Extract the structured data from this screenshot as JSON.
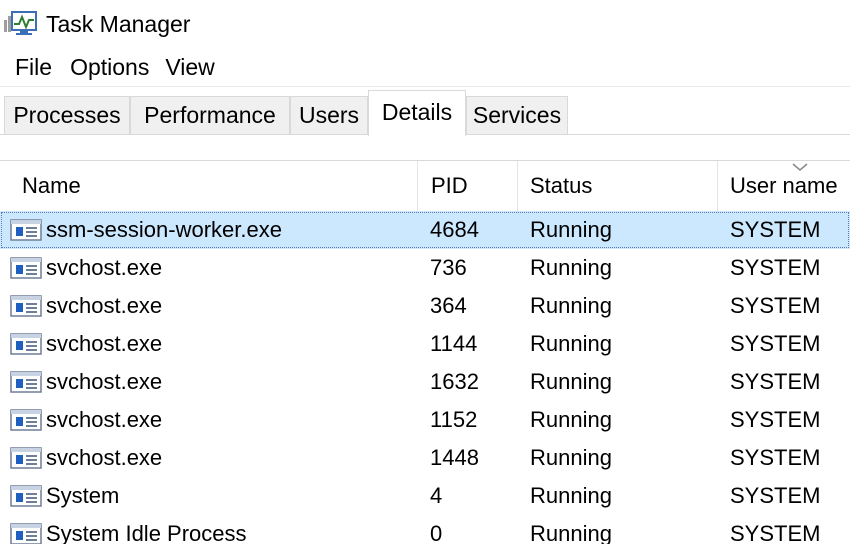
{
  "window": {
    "title": "Task Manager",
    "icon": "task-manager-icon"
  },
  "menu": {
    "items": [
      "File",
      "Options",
      "View"
    ]
  },
  "tabs": [
    {
      "label": "Processes",
      "active": false
    },
    {
      "label": "Performance",
      "active": false
    },
    {
      "label": "Users",
      "active": false
    },
    {
      "label": "Details",
      "active": true
    },
    {
      "label": "Services",
      "active": false
    }
  ],
  "table": {
    "columns": [
      "Name",
      "PID",
      "Status",
      "User name"
    ],
    "sorted_column": "User name",
    "rows": [
      {
        "name": "ssm-session-worker.exe",
        "pid": "4684",
        "status": "Running",
        "user": "SYSTEM",
        "selected": true
      },
      {
        "name": "svchost.exe",
        "pid": "736",
        "status": "Running",
        "user": "SYSTEM"
      },
      {
        "name": "svchost.exe",
        "pid": "364",
        "status": "Running",
        "user": "SYSTEM"
      },
      {
        "name": "svchost.exe",
        "pid": "1144",
        "status": "Running",
        "user": "SYSTEM"
      },
      {
        "name": "svchost.exe",
        "pid": "1632",
        "status": "Running",
        "user": "SYSTEM"
      },
      {
        "name": "svchost.exe",
        "pid": "1152",
        "status": "Running",
        "user": "SYSTEM"
      },
      {
        "name": "svchost.exe",
        "pid": "1448",
        "status": "Running",
        "user": "SYSTEM"
      },
      {
        "name": "System",
        "pid": "4",
        "status": "Running",
        "user": "SYSTEM"
      },
      {
        "name": "System Idle Process",
        "pid": "0",
        "status": "Running",
        "user": "SYSTEM"
      }
    ]
  },
  "colors": {
    "selection": "#cce8ff",
    "tab_inactive": "#f0f0f0",
    "border": "#d9d9d9",
    "icon_blue": "#1f5fbf"
  }
}
